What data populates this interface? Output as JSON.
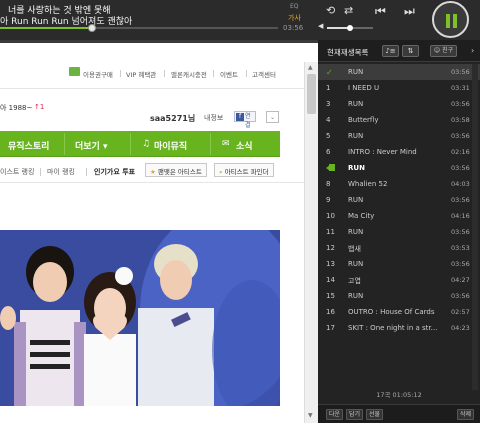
{
  "player": {
    "lyric_line1": "너를 사랑하는 것 밖엔 못해",
    "lyric_line2": "아 Run Run Run 넘어져도 괜찮아",
    "eq_label": "EQ",
    "lyrics_label": "가사",
    "elapsed": "03:56",
    "progress_fraction": 0.33,
    "volume_fraction": 0.5,
    "accent": "#7cc226"
  },
  "browser": {
    "util_links": [
      "이용권구매",
      "VIP 혜택관",
      "멜론캐시충전",
      "이벤트",
      "고객센터"
    ],
    "fragment": "아 1988~",
    "fragment_rank": "↑1",
    "username": "saa5271님",
    "my_info": "내정보",
    "fb_link": "연결",
    "gnb": [
      "뮤직스토리",
      "더보기 ▾",
      "마이뮤직",
      "소식"
    ],
    "submenu": [
      "이스트 랭킹",
      "마이 랭킹",
      "인기가요 투표"
    ],
    "sub_buttons": [
      "팬맺은 아티스트",
      "아티스트 파인더"
    ]
  },
  "playlist": {
    "title": "현재재생목록",
    "btn_friend": "친구",
    "rows": [
      {
        "num": "",
        "title": "RUN",
        "dur": "03:56",
        "state": "selected"
      },
      {
        "num": "1",
        "title": "I NEED U",
        "dur": "03:31",
        "state": ""
      },
      {
        "num": "3",
        "title": "RUN",
        "dur": "03:56",
        "state": ""
      },
      {
        "num": "4",
        "title": "Butterfly",
        "dur": "03:58",
        "state": ""
      },
      {
        "num": "5",
        "title": "RUN",
        "dur": "03:56",
        "state": ""
      },
      {
        "num": "6",
        "title": "INTRO : Never Mind",
        "dur": "02:16",
        "state": ""
      },
      {
        "num": "",
        "title": "RUN",
        "dur": "03:56",
        "state": "playing"
      },
      {
        "num": "8",
        "title": "Whalien 52",
        "dur": "04:03",
        "state": ""
      },
      {
        "num": "9",
        "title": "RUN",
        "dur": "03:56",
        "state": ""
      },
      {
        "num": "10",
        "title": "Ma City",
        "dur": "04:16",
        "state": ""
      },
      {
        "num": "11",
        "title": "RUN",
        "dur": "03:56",
        "state": ""
      },
      {
        "num": "12",
        "title": "뱁새",
        "dur": "03:53",
        "state": ""
      },
      {
        "num": "13",
        "title": "RUN",
        "dur": "03:56",
        "state": ""
      },
      {
        "num": "14",
        "title": "고엽",
        "dur": "04:27",
        "state": ""
      },
      {
        "num": "15",
        "title": "RUN",
        "dur": "03:56",
        "state": ""
      },
      {
        "num": "16",
        "title": "OUTRO : House Of Cards",
        "dur": "02:57",
        "state": ""
      },
      {
        "num": "17",
        "title": "SKIT : One night in a str...",
        "dur": "04:23",
        "state": ""
      }
    ],
    "summary": "17곡 01:05:12",
    "footer_buttons": [
      "다운",
      "담기",
      "선물",
      "삭제"
    ]
  }
}
